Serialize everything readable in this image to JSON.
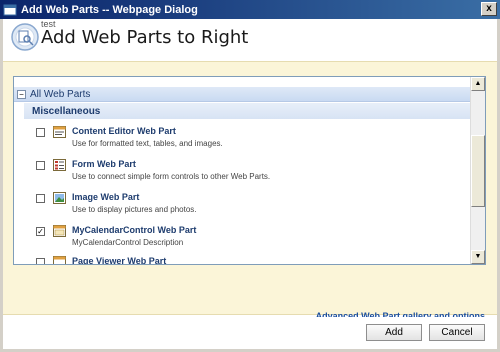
{
  "window": {
    "title": "Add Web Parts -- Webpage Dialog",
    "close_glyph": "x"
  },
  "header": {
    "site_name": "test",
    "page_title": "Add Web Parts to Right"
  },
  "list": {
    "collapse_glyph": "−",
    "category": "All Web Parts",
    "subcategory": "Miscellaneous",
    "check_glyph": "✓",
    "parts": [
      {
        "name": "Content Editor Web Part",
        "description": "Use for formatted text, tables, and images.",
        "checked": false,
        "icon": "content-editor-icon"
      },
      {
        "name": "Form Web Part",
        "description": "Use to connect simple form controls to other Web Parts.",
        "checked": false,
        "icon": "form-icon"
      },
      {
        "name": "Image Web Part",
        "description": "Use to display pictures and photos.",
        "checked": false,
        "icon": "image-icon"
      },
      {
        "name": "MyCalendarControl Web Part",
        "description": "MyCalendarControl Description",
        "checked": true,
        "icon": "calendar-control-icon"
      },
      {
        "name": "Page Viewer Web Part",
        "description": "",
        "checked": false,
        "icon": "page-viewer-icon"
      }
    ]
  },
  "advanced_link": "Advanced Web Part gallery and options",
  "buttons": {
    "add": "Add",
    "cancel": "Cancel"
  },
  "colors": {
    "title_bar": "#0a246a",
    "body_bg": "#fbf5d8",
    "category_bg": "#c9daf2",
    "link": "#1b4f9e"
  }
}
